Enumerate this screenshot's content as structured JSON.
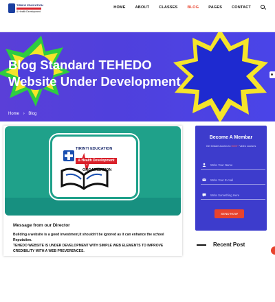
{
  "header": {
    "logo_line1": "TIRINYI EDUCATION",
    "logo_line2": "& Health Development",
    "nav": [
      "HOME",
      "ABOUT",
      "CLASSES",
      "BLOG",
      "PAGES",
      "CONTACT"
    ],
    "active_nav": "BLOG",
    "search_icon": "search-icon"
  },
  "hero": {
    "title": "Blog Standard TEHEDO Website Under Development",
    "breadcrumb_home": "Home",
    "breadcrumb_current": "Blog",
    "breadcrumb_icon": "chevron-right-icon"
  },
  "post": {
    "org_line1": "TIRINYI EDUCATION",
    "org_line2": "& Health Development",
    "org_line3": "ORGANISATION",
    "message_title": "Message from our Director",
    "body_line1": "Building a website is a good investment,it shouldn't be ignored as it can enhance the school Reputation.",
    "body_line2": "TEHEDO WEBSITE IS UNDER DEVELOPMENT WITH SIMPLE WEB ELEMENTS TO IMPROVE",
    "body_line3": "CREDIBILITY WITH A WEB PREVERENCES."
  },
  "signup": {
    "title": "Become A Membar",
    "subtitle_prefix": "Get Instant access to ",
    "subtitle_highlight": "5000+",
    "subtitle_suffix": " Video courses",
    "name_placeholder": "Write Your Name",
    "email_placeholder": "Write Your E-mail",
    "message_placeholder": "Write Something Here",
    "send_label": "SEND NOW",
    "field_icons": [
      "user-icon",
      "email-icon",
      "message-icon"
    ]
  },
  "sidebar": {
    "recent_title": "Recent Post"
  },
  "colors": {
    "accent": "#e8432d",
    "hero_bg": "#5040dc",
    "form_bg": "#3d3ccc",
    "teal": "#1fa18a",
    "yellow": "#f5e42a",
    "green": "#2ecc40"
  }
}
